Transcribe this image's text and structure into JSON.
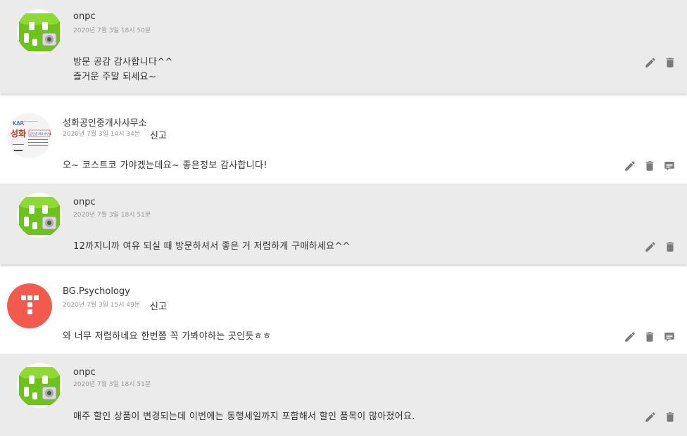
{
  "comments": [
    {
      "author": "onpc",
      "date": "2020년 7월 3일 18시 50분",
      "lines": "방문 공감 감사합니다^^\n즐거운 주말 되세요~"
    },
    {
      "author": "성화공인중개사사무소",
      "date": "2020년 7월 3일 14시 34분",
      "report": "신고",
      "text": "오~ 코스트코 가야겠는데요~ 좋은정보 감사합니다!"
    },
    {
      "author": "onpc",
      "date": "2020년 7월 3일 18시 51분",
      "text": "12까지니까 여유 되실 때 방문하셔서 좋은 거 저렴하게 구매하세요^^"
    },
    {
      "author": "BG.Psychology",
      "date": "2020년 7월 3일 15시 49분",
      "report": "신고",
      "text": "와 너무 저렴하네요 한번쯤 꼭 가봐야하는 곳인듯ㅎㅎ"
    },
    {
      "author": "onpc",
      "date": "2020년 7월 3일 18시 51분",
      "text": "매주 할인 상품이 변경되는데 이번에는 동행세일까지 포함해서 할인 품목이 많아졌어요."
    }
  ],
  "logo_text": {
    "line1": "KAR",
    "line2": "성화",
    "line3": "공인중개사사무소"
  },
  "colors": {
    "reply_bg": "#ebebeb",
    "avatar_green": "#6ec21c",
    "avatar_red": "#f25a4d",
    "icon_gray": "#7a7a7a"
  },
  "icons": [
    "edit-icon",
    "delete-icon",
    "reply-icon"
  ]
}
